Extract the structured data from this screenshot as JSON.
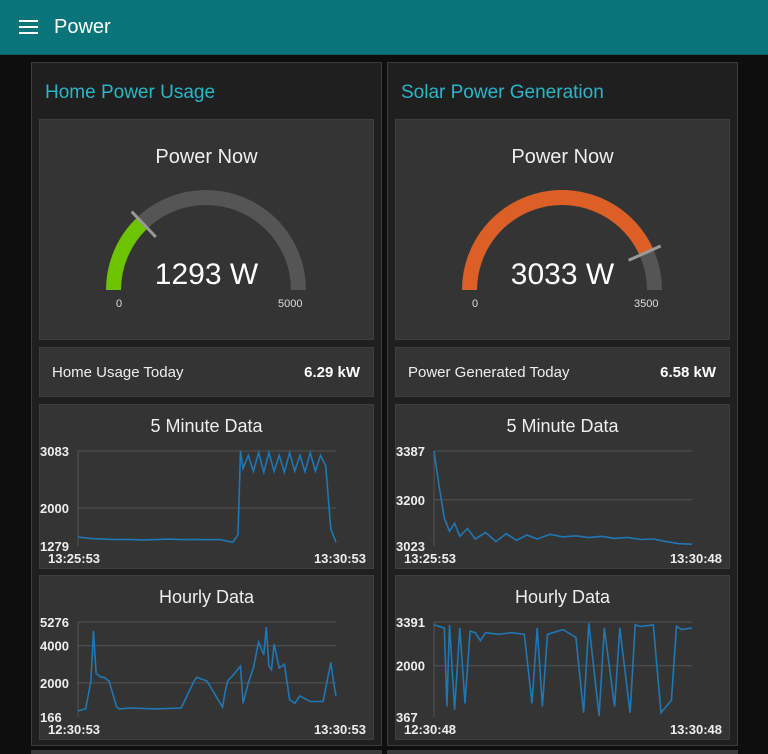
{
  "header": {
    "title": "Power",
    "menu_icon": "hamburger-menu-icon"
  },
  "colors": {
    "toolbar": "#097479",
    "group_title": "#29b6c9",
    "line": "#1f77b4",
    "home_gauge": "#6fc400",
    "solar_gauge": "#dc6026",
    "gauge_track": "#555555"
  },
  "groups": [
    {
      "title": "Home Power Usage",
      "gauge": {
        "title": "Power Now",
        "value": 1293,
        "value_text": "1293 W",
        "min": 0,
        "max": 5000,
        "min_label": "0",
        "max_label": "5000",
        "color": "#6fc400"
      },
      "today": {
        "label": "Home Usage Today",
        "value": "6.29 kW"
      },
      "chart_5min": {
        "title": "5 Minute Data",
        "y_min_label": "1279",
        "y_mid_label": "2000",
        "y_max_label": "3083",
        "x_start_label": "13:25:53",
        "x_end_label": "13:30:53"
      },
      "chart_hourly": {
        "title": "Hourly Data",
        "y_min_label": "166",
        "y_mid1_label": "2000",
        "y_mid2_label": "4000",
        "y_max_label": "5276",
        "x_start_label": "12:30:53",
        "x_end_label": "13:30:53"
      }
    },
    {
      "title": "Solar Power Generation",
      "gauge": {
        "title": "Power Now",
        "value": 3033,
        "value_text": "3033 W",
        "min": 0,
        "max": 3500,
        "min_label": "0",
        "max_label": "3500",
        "color": "#dc6026"
      },
      "today": {
        "label": "Power Generated Today",
        "value": "6.58 kW"
      },
      "chart_5min": {
        "title": "5 Minute Data",
        "y_min_label": "3023",
        "y_mid_label": "3200",
        "y_max_label": "3387",
        "x_start_label": "13:25:53",
        "x_end_label": "13:30:48"
      },
      "chart_hourly": {
        "title": "Hourly Data",
        "y_min_label": "367",
        "y_mid_label": "2000",
        "y_max_label": "3391",
        "x_start_label": "12:30:48",
        "x_end_label": "13:30:48"
      }
    }
  ],
  "chart_data": [
    {
      "type": "line",
      "title": "5 Minute Data",
      "group": "Home Power Usage",
      "ylim": [
        1279,
        3083
      ],
      "x": [
        0,
        0.05,
        0.1,
        0.15,
        0.2,
        0.25,
        0.3,
        0.35,
        0.4,
        0.45,
        0.5,
        0.55,
        0.6,
        0.62,
        0.63,
        0.64,
        0.66,
        0.68,
        0.7,
        0.72,
        0.74,
        0.76,
        0.78,
        0.8,
        0.82,
        0.84,
        0.86,
        0.88,
        0.9,
        0.92,
        0.94,
        0.96,
        0.98,
        1.0
      ],
      "values": [
        1450,
        1420,
        1410,
        1400,
        1405,
        1395,
        1400,
        1410,
        1400,
        1405,
        1398,
        1402,
        1350,
        1500,
        3083,
        2750,
        3000,
        2700,
        3050,
        2680,
        3050,
        2700,
        3000,
        2680,
        3050,
        2700,
        3000,
        2690,
        3050,
        2700,
        3000,
        2800,
        1600,
        1350
      ]
    },
    {
      "type": "line",
      "title": "5 Minute Data",
      "group": "Solar Power Generation",
      "ylim": [
        3023,
        3387
      ],
      "x": [
        0,
        0.02,
        0.04,
        0.06,
        0.08,
        0.1,
        0.13,
        0.16,
        0.2,
        0.24,
        0.28,
        0.32,
        0.36,
        0.4,
        0.45,
        0.5,
        0.55,
        0.6,
        0.65,
        0.7,
        0.75,
        0.8,
        0.85,
        0.9,
        0.95,
        1.0
      ],
      "values": [
        3387,
        3250,
        3130,
        3080,
        3110,
        3060,
        3090,
        3050,
        3075,
        3040,
        3070,
        3045,
        3065,
        3050,
        3068,
        3058,
        3062,
        3055,
        3060,
        3052,
        3056,
        3048,
        3050,
        3040,
        3032,
        3030
      ]
    },
    {
      "type": "line",
      "title": "Hourly Data",
      "group": "Home Power Usage",
      "ylim": [
        166,
        5276
      ],
      "x": [
        0,
        0.03,
        0.05,
        0.06,
        0.07,
        0.09,
        0.1,
        0.12,
        0.15,
        0.16,
        0.2,
        0.3,
        0.4,
        0.45,
        0.46,
        0.5,
        0.56,
        0.57,
        0.58,
        0.6,
        0.63,
        0.64,
        0.66,
        0.68,
        0.7,
        0.72,
        0.73,
        0.74,
        0.75,
        0.76,
        0.78,
        0.8,
        0.82,
        0.84,
        0.86,
        0.9,
        0.95,
        0.98,
        0.99,
        1.0
      ],
      "values": [
        500,
        600,
        2100,
        4800,
        2500,
        2300,
        2300,
        2100,
        700,
        600,
        650,
        600,
        650,
        2100,
        2300,
        2100,
        700,
        1500,
        2100,
        2400,
        2900,
        900,
        2000,
        2800,
        4200,
        3500,
        5000,
        2900,
        2700,
        4100,
        2800,
        3000,
        1100,
        900,
        1300,
        1000,
        1000,
        3100,
        2100,
        1300
      ]
    },
    {
      "type": "line",
      "title": "Hourly Data",
      "group": "Solar Power Generation",
      "ylim": [
        367,
        3391
      ],
      "x": [
        0,
        0.04,
        0.05,
        0.06,
        0.08,
        0.1,
        0.12,
        0.14,
        0.16,
        0.18,
        0.2,
        0.25,
        0.3,
        0.35,
        0.38,
        0.4,
        0.42,
        0.44,
        0.5,
        0.55,
        0.58,
        0.6,
        0.64,
        0.66,
        0.7,
        0.72,
        0.76,
        0.78,
        0.8,
        0.85,
        0.88,
        0.92,
        0.94,
        0.96,
        1.0
      ],
      "values": [
        3300,
        3200,
        700,
        3300,
        600,
        3200,
        800,
        3100,
        3050,
        2800,
        3050,
        3000,
        3050,
        3000,
        800,
        3200,
        700,
        3000,
        3150,
        2900,
        500,
        3350,
        400,
        3200,
        700,
        3200,
        500,
        3300,
        3250,
        3300,
        500,
        900,
        3250,
        3150,
        3200
      ]
    }
  ]
}
